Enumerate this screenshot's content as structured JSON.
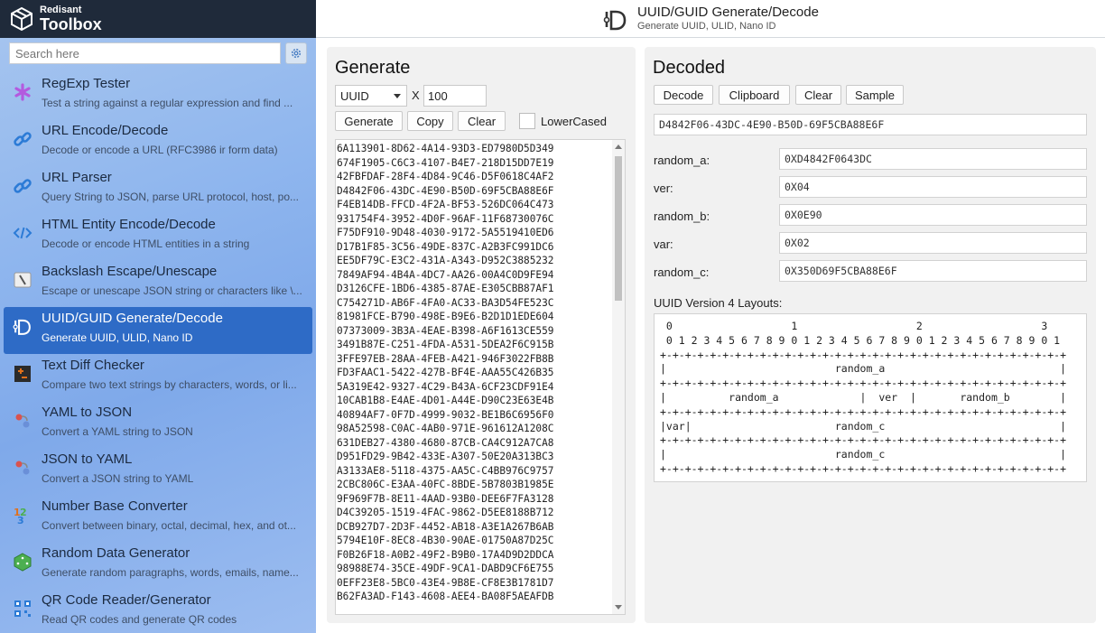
{
  "brand": {
    "line1": "Redisant",
    "line2": "Toolbox"
  },
  "search": {
    "placeholder": "Search here"
  },
  "tools": [
    {
      "name": "RegExp Tester",
      "desc": "Test a string against a regular expression and find ...",
      "icon": "asterisk-icon",
      "color": "#b35adf"
    },
    {
      "name": "URL Encode/Decode",
      "desc": "Decode or encode a URL (RFC3986 ir form data)",
      "icon": "link-icon",
      "color": "#2c7bd6"
    },
    {
      "name": "URL Parser",
      "desc": "Query String to JSON, parse URL protocol, host, po...",
      "icon": "link-icon",
      "color": "#2c7bd6"
    },
    {
      "name": "HTML Entity Encode/Decode",
      "desc": "Decode or encode HTML entities in a string",
      "icon": "code-icon",
      "color": "#2c7bd6"
    },
    {
      "name": "Backslash Escape/Unescape",
      "desc": "Escape or unescape JSON string or characters like \\...",
      "icon": "backslash-icon",
      "color": "#555555"
    },
    {
      "name": "UUID/GUID Generate/Decode",
      "desc": "Generate UUID, ULID, Nano ID",
      "icon": "uuid-icon",
      "color": "#ffffff",
      "active": true
    },
    {
      "name": "Text Diff Checker",
      "desc": "Compare two text strings by characters, words, or li...",
      "icon": "diff-icon",
      "color": "#e0701a"
    },
    {
      "name": "YAML to JSON",
      "desc": "Convert a YAML string to JSON",
      "icon": "convert-icon",
      "color": "#d9534f"
    },
    {
      "name": "JSON to YAML",
      "desc": "Convert a JSON string to YAML",
      "icon": "convert-icon",
      "color": "#d9534f"
    },
    {
      "name": "Number Base Converter",
      "desc": "Convert between binary, octal, decimal, hex, and ot...",
      "icon": "numbers-icon",
      "color": "#e0701a"
    },
    {
      "name": "Random Data Generator",
      "desc": "Generate random paragraphs, words, emails, name...",
      "icon": "dice-icon",
      "color": "#4caf50"
    },
    {
      "name": "QR Code Reader/Generator",
      "desc": "Read QR codes and generate QR codes",
      "icon": "qr-icon",
      "color": "#2c7bd6"
    }
  ],
  "header": {
    "title": "UUID/GUID Generate/Decode",
    "subtitle": "Generate UUID, ULID, Nano ID"
  },
  "generate": {
    "title": "Generate",
    "type": "UUID",
    "times": "X",
    "count": "100",
    "buttons": {
      "generate": "Generate",
      "copy": "Copy",
      "clear": "Clear"
    },
    "lowercased_label": "LowerCased",
    "uuids": [
      "6A113901-8D62-4A14-93D3-ED7980D5D349",
      "674F1905-C6C3-4107-B4E7-218D15DD7E19",
      "42FBFDAF-28F4-4D84-9C46-D5F0618C4AF2",
      "D4842F06-43DC-4E90-B50D-69F5CBA88E6F",
      "F4EB14DB-FFCD-4F2A-BF53-526DC064C473",
      "931754F4-3952-4D0F-96AF-11F68730076C",
      "F75DF910-9D48-4030-9172-5A5519410ED6",
      "D17B1F85-3C56-49DE-837C-A2B3FC991DC6",
      "EE5DF79C-E3C2-431A-A343-D952C3885232",
      "7849AF94-4B4A-4DC7-AA26-00A4C0D9FE94",
      "D3126CFE-1BD6-4385-87AE-E305CBB87AF1",
      "C754271D-AB6F-4FA0-AC33-BA3D54FE523C",
      "81981FCE-B790-498E-B9E6-B2D1D1EDE604",
      "07373009-3B3A-4EAE-B398-A6F1613CE559",
      "3491B87E-C251-4FDA-A531-5DEA2F6C915B",
      "3FFE97EB-28AA-4FEB-A421-946F3022FB8B",
      "FD3FAAC1-5422-427B-BF4E-AAA55C426B35",
      "5A319E42-9327-4C29-B43A-6CF23CDF91E4",
      "10CAB1B8-E4AE-4D01-A44E-D90C23E63E4B",
      "40894AF7-0F7D-4999-9032-BE1B6C6956F0",
      "98A52598-C0AC-4AB0-971E-961612A1208C",
      "631DEB27-4380-4680-87CB-CA4C912A7CA8",
      "D951FD29-9B42-433E-A307-50E20A313BC3",
      "A3133AE8-5118-4375-AA5C-C4BB976C9757",
      "2CBC806C-E3AA-40FC-8BDE-5B7803B1985E",
      "9F969F7B-8E11-4AAD-93B0-DEE6F7FA3128",
      "D4C39205-1519-4FAC-9862-D5EE8188B712",
      "DCB927D7-2D3F-4452-AB18-A3E1A267B6AB",
      "5794E10F-8EC8-4B30-90AE-01750A87D25C",
      "F0B26F18-A0B2-49F2-B9B0-17A4D9D2DDCA",
      "98988E74-35CE-49DF-9CA1-DABD9CF6E755",
      "0EFF23E8-5BC0-43E4-9B8E-CF8E3B1781D7",
      "B62FA3AD-F143-4608-AEE4-BA08F5AEAFDB"
    ]
  },
  "decoded": {
    "title": "Decoded",
    "buttons": {
      "decode": "Decode",
      "clipboard": "Clipboard",
      "clear": "Clear",
      "sample": "Sample"
    },
    "input": "D4842F06-43DC-4E90-B50D-69F5CBA88E6F",
    "fields": [
      {
        "label": "random_a:",
        "value": "0XD4842F0643DC"
      },
      {
        "label": "ver:",
        "value": "0X04"
      },
      {
        "label": "random_b:",
        "value": "0X0E90"
      },
      {
        "label": "var:",
        "value": "0X02"
      },
      {
        "label": "random_c:",
        "value": "0X350D69F5CBA88E6F"
      }
    ],
    "layout_label": "UUID Version 4 Layouts:",
    "layout_lines": [
      " 0                   1                   2                   3",
      " 0 1 2 3 4 5 6 7 8 9 0 1 2 3 4 5 6 7 8 9 0 1 2 3 4 5 6 7 8 9 0 1",
      "+-+-+-+-+-+-+-+-+-+-+-+-+-+-+-+-+-+-+-+-+-+-+-+-+-+-+-+-+-+-+-+-+",
      "|                           random_a                            |",
      "+-+-+-+-+-+-+-+-+-+-+-+-+-+-+-+-+-+-+-+-+-+-+-+-+-+-+-+-+-+-+-+-+",
      "|          random_a             |  ver  |       random_b        |",
      "+-+-+-+-+-+-+-+-+-+-+-+-+-+-+-+-+-+-+-+-+-+-+-+-+-+-+-+-+-+-+-+-+",
      "|var|                       random_c                            |",
      "+-+-+-+-+-+-+-+-+-+-+-+-+-+-+-+-+-+-+-+-+-+-+-+-+-+-+-+-+-+-+-+-+",
      "|                           random_c                            |",
      "+-+-+-+-+-+-+-+-+-+-+-+-+-+-+-+-+-+-+-+-+-+-+-+-+-+-+-+-+-+-+-+-+"
    ]
  }
}
